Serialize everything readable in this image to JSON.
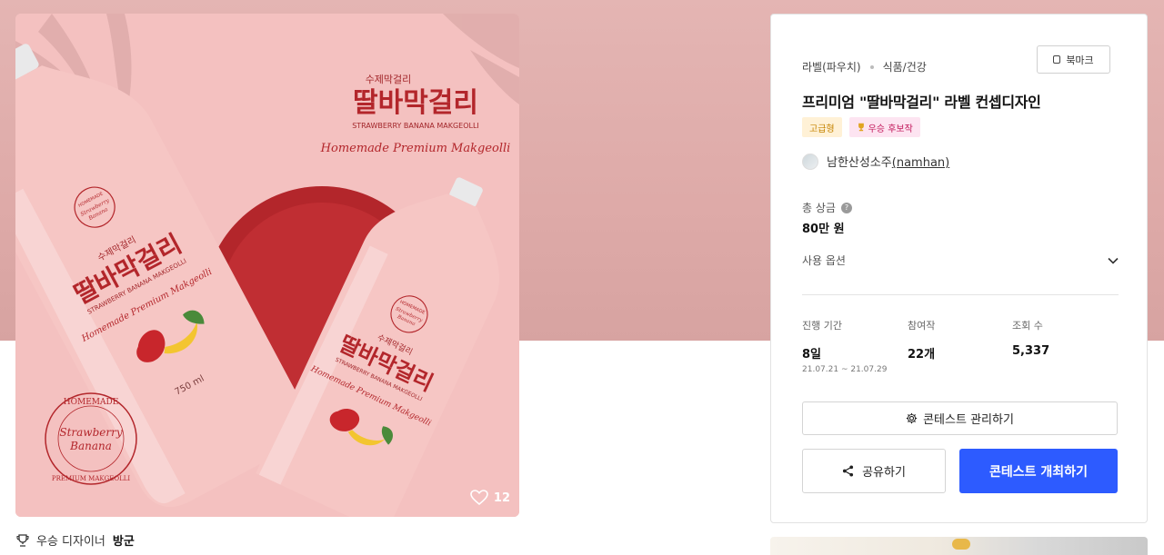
{
  "image": {
    "likes": "12",
    "bottle_big": {
      "brand_small": "수제막걸리",
      "brand": "딸바막걸리",
      "eng": "STRAWBERRY BANANA MAKGEOLLI",
      "script": "Homemade Premium Makgeolli",
      "volume": "750 ml"
    },
    "poster": {
      "brand_small": "수제막걸리",
      "brand": "딸바막걸리",
      "eng": "STRAWBERRY BANANA MAKGEOLLI",
      "script": "Homemade Premium Makgeolli"
    },
    "bottle_small": {
      "brand_small": "수제막걸리",
      "brand": "딸바막걸리",
      "eng": "STRAWBERRY BANANA MAKGEOLLI",
      "script": "Homemade Premium Makgeolli"
    },
    "seal": {
      "top": "HOMEMADE",
      "center1": "Strawberry",
      "center2": "Banana",
      "bottom": "PREMIUM MAKGEOLLI"
    },
    "small_seal": {
      "line1": "HOMEMADE",
      "line2": "Strawberry",
      "line3": "Banana"
    }
  },
  "winner": {
    "label": "우승 디자이너",
    "name": "방군"
  },
  "panel": {
    "category": "라벨(파우치)",
    "subcategory": "식품/건강",
    "bookmark_label": "북마크",
    "title": "프리미엄 \"딸바막걸리\" 라벨 컨셉디자인",
    "badge_grade": "고급형",
    "badge_winner": "우승 후보작",
    "author_name": "남한산성소주",
    "author_id": "(namhan)",
    "prize_label": "총 상금",
    "prize_value": "80만 원",
    "options_label": "사용 옵션",
    "stats": {
      "duration_label": "진행 기간",
      "duration_value": "8일",
      "duration_range": "21.07.21  ~  21.07.29",
      "participants_label": "참여작",
      "participants_value": "22개",
      "views_label": "조회 수",
      "views_value": "5,337"
    },
    "manage_label": "콘테스트 관리하기",
    "share_label": "공유하기",
    "host_label": "콘테스트 개최하기"
  },
  "colors": {
    "accent": "#2d5bff",
    "hero": "#e0aeac",
    "brand_red": "#b3262b",
    "bottle_pink": "#f5c2c0"
  },
  "icons": {
    "heart": "heart-icon",
    "trophy": "trophy-icon",
    "bookmark": "bookmark-icon",
    "help": "help-icon",
    "chevron": "chevron-down-icon",
    "gear": "gear-icon",
    "share": "share-icon"
  }
}
